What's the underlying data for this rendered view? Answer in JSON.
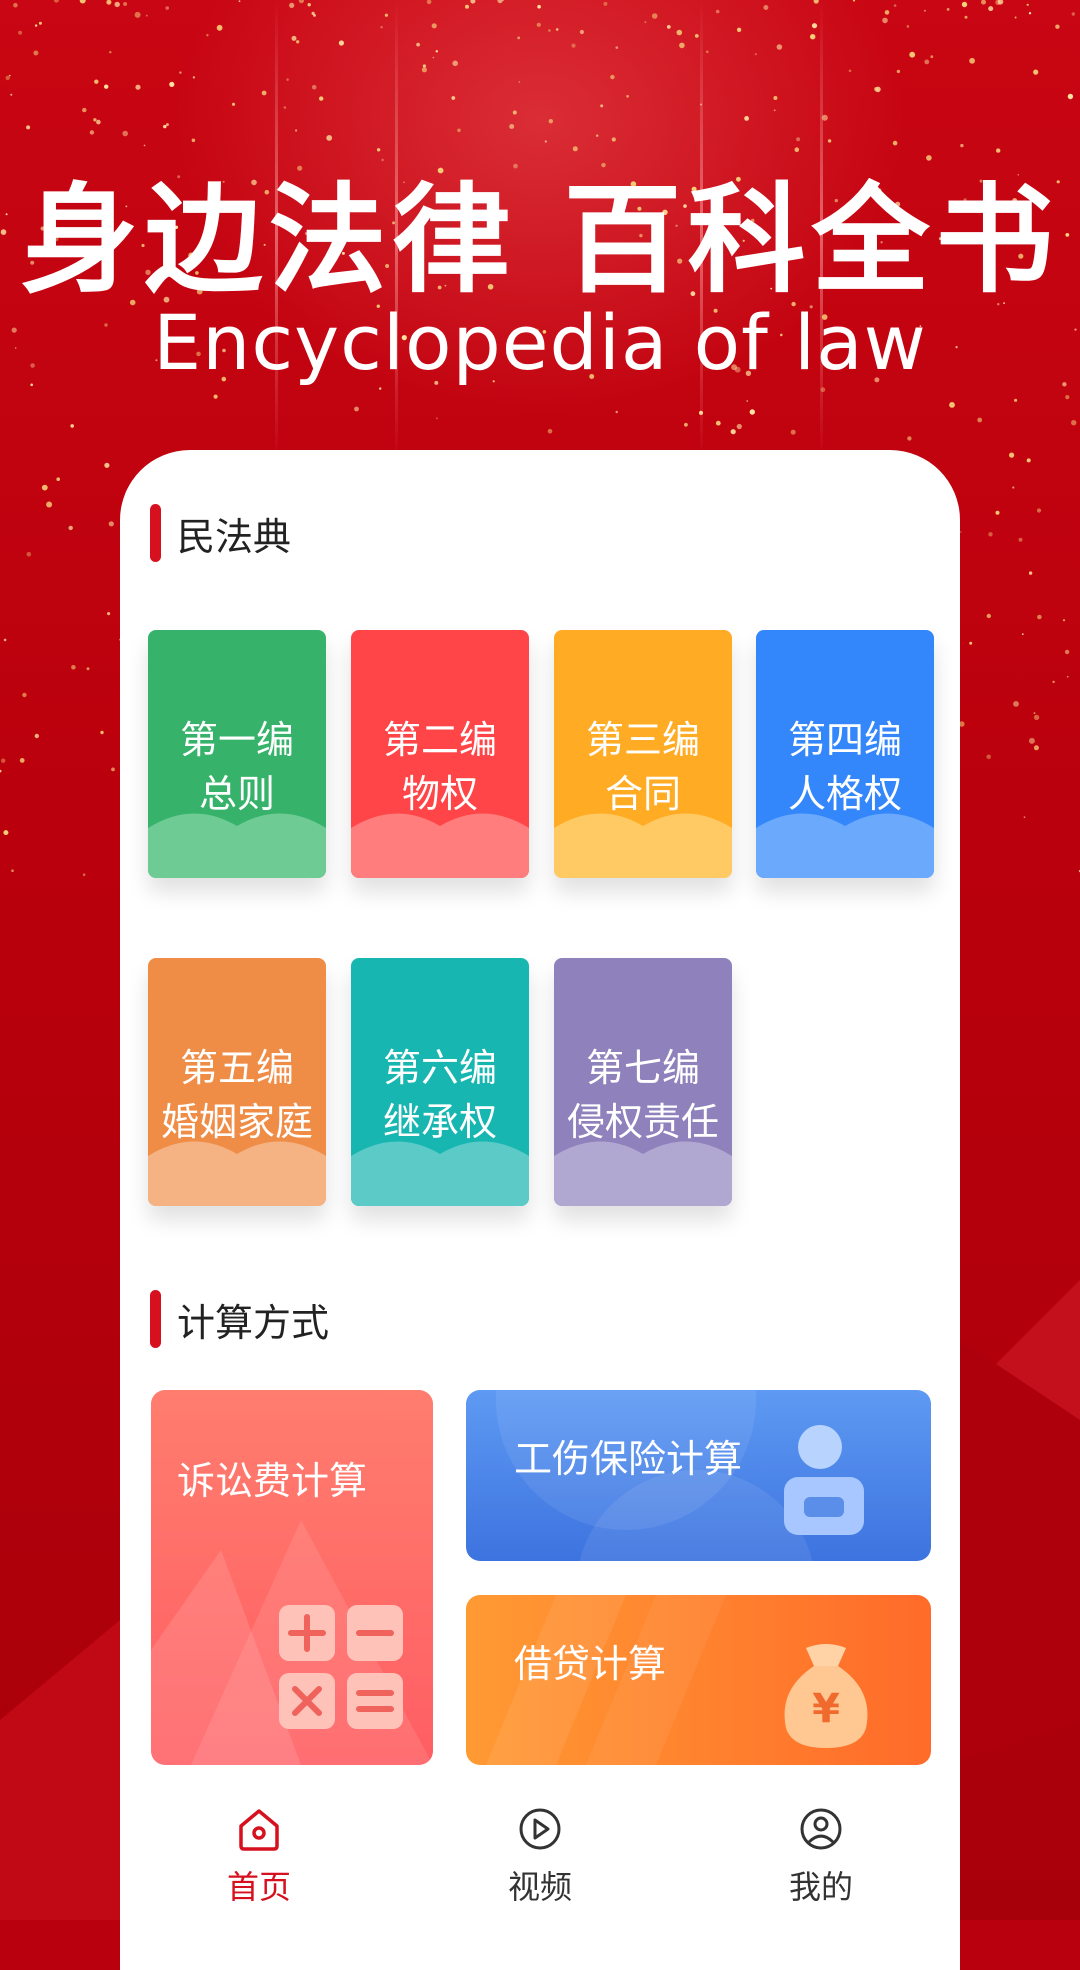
{
  "hero": {
    "title": "身边法律 百科全书",
    "subtitle": "Encyclopedia of law"
  },
  "civil_code": {
    "title": "民法典",
    "books": [
      {
        "line1": "第一编",
        "line2": "总则",
        "color": "#36b26a",
        "cloud": "#6fcb94"
      },
      {
        "line1": "第二编",
        "line2": "物权",
        "color": "#ff4547",
        "cloud": "#ff7d7c"
      },
      {
        "line1": "第三编",
        "line2": "合同",
        "color": "#ffab24",
        "cloud": "#ffc964"
      },
      {
        "line1": "第四编",
        "line2": "人格权",
        "color": "#3486fb",
        "cloud": "#6aa9fc"
      },
      {
        "line1": "第五编",
        "line2": "婚姻家庭",
        "color": "#ef8d47",
        "cloud": "#f5b384"
      },
      {
        "line1": "第六编",
        "line2": "继承权",
        "color": "#17b6b0",
        "cloud": "#5ccbc8"
      },
      {
        "line1": "第七编",
        "line2": "侵权责任",
        "color": "#8e81bc",
        "cloud": "#b1a8d2"
      }
    ]
  },
  "calculators": {
    "title": "计算方式",
    "items": [
      {
        "label": "诉讼费计算",
        "icon": "calculator-icon"
      },
      {
        "label": "工伤保险计算",
        "icon": "injured-worker-icon"
      },
      {
        "label": "借贷计算",
        "icon": "money-bag-icon"
      }
    ]
  },
  "nav": {
    "items": [
      {
        "label": "首页",
        "icon": "home-icon",
        "active": true
      },
      {
        "label": "视频",
        "icon": "video-play-icon",
        "active": false
      },
      {
        "label": "我的",
        "icon": "user-profile-icon",
        "active": false
      }
    ],
    "active_color": "#d6101e",
    "inactive_color": "#333333"
  }
}
